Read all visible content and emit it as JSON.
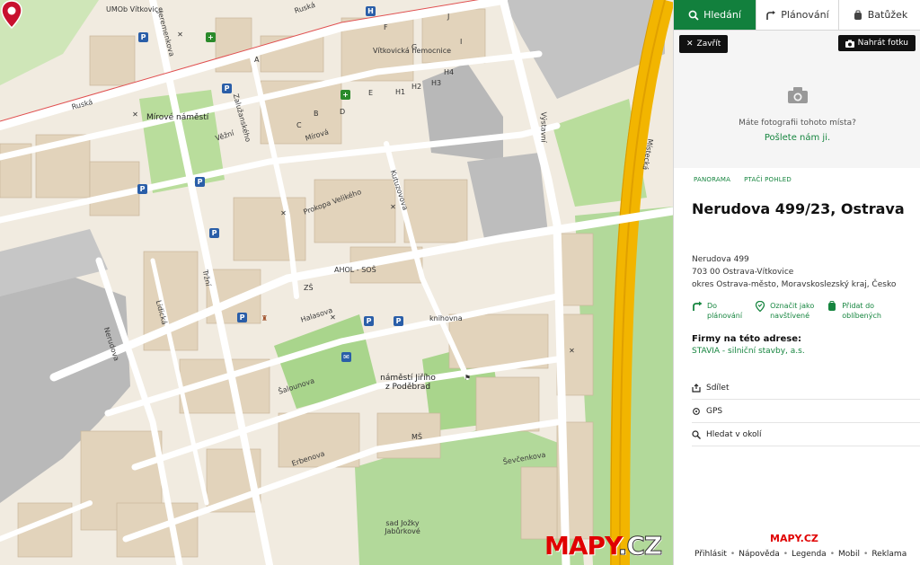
{
  "tabs": [
    {
      "label": "Hledání",
      "icon": "search-icon",
      "active": true
    },
    {
      "label": "Plánování",
      "icon": "route-icon",
      "active": false
    },
    {
      "label": "Batůžek",
      "icon": "backpack-icon",
      "active": false
    }
  ],
  "photo": {
    "close_label": "Zavřít",
    "upload_label": "Nahrát fotku",
    "question": "Máte fotografii tohoto místa?",
    "cta": "Pošlete nám ji."
  },
  "views": {
    "panorama": "PANORAMA",
    "bird": "PTAČÍ POHLED"
  },
  "place": {
    "title": "Nerudova 499/23, Ostrava",
    "address_line1": "Nerudova 499",
    "address_line2": "703 00  Ostrava-Vítkovice",
    "address_line3": "okres Ostrava-město, Moravskoslezský kraj, Česko"
  },
  "actions": [
    {
      "label1": "Do",
      "label2": "plánování",
      "icon": "route-arrow-icon"
    },
    {
      "label1": "Označit jako",
      "label2": "navštívené",
      "icon": "visited-pin-icon"
    },
    {
      "label1": "Přidat do",
      "label2": "oblíbených",
      "icon": "favorites-icon"
    }
  ],
  "firms": {
    "heading": "Firmy na této adrese:",
    "item": "STAVIA - silniční stavby, a.s."
  },
  "menu": [
    {
      "label": "Sdílet",
      "icon": "share-icon"
    },
    {
      "label": "GPS",
      "icon": "gps-icon"
    },
    {
      "label": "Hledat v okolí",
      "icon": "search-nearby-icon"
    }
  ],
  "footer": {
    "logo": "MAPY.CZ",
    "links": [
      "Přihlásit",
      "Nápověda",
      "Legenda",
      "Mobil",
      "Reklama"
    ]
  },
  "map": {
    "logo_a": "MAPY",
    "logo_b": ".CZ",
    "areas": [
      "UMOb Vítkovice",
      "Mírové náměstí",
      "Vítkovická nemocnice",
      "AHOL - SOŠ",
      "náměstí Jiřího z Poděbrad",
      "knihovna",
      "sad Jožky Jabůrkové",
      "ZŠ",
      "MŠ"
    ],
    "streets": [
      "Ruská",
      "Jeremenkova",
      "Mírová",
      "Zalužanského",
      "Výstavní",
      "Halasova",
      "Prokopa Velikého",
      "Kutuzovova",
      "Tržní",
      "Lidická",
      "Nerudova",
      "Šalounova",
      "Erbenova",
      "Ševčenkova",
      "Místecká",
      "Věžní",
      "Ruská"
    ],
    "buildings": [
      "A",
      "B",
      "C",
      "D",
      "E",
      "F",
      "G",
      "H1",
      "H2",
      "H3",
      "H4",
      "I",
      "J"
    ]
  },
  "colors": {
    "accent": "#12803d",
    "link": "#16853f",
    "pin": "#c8102e"
  }
}
